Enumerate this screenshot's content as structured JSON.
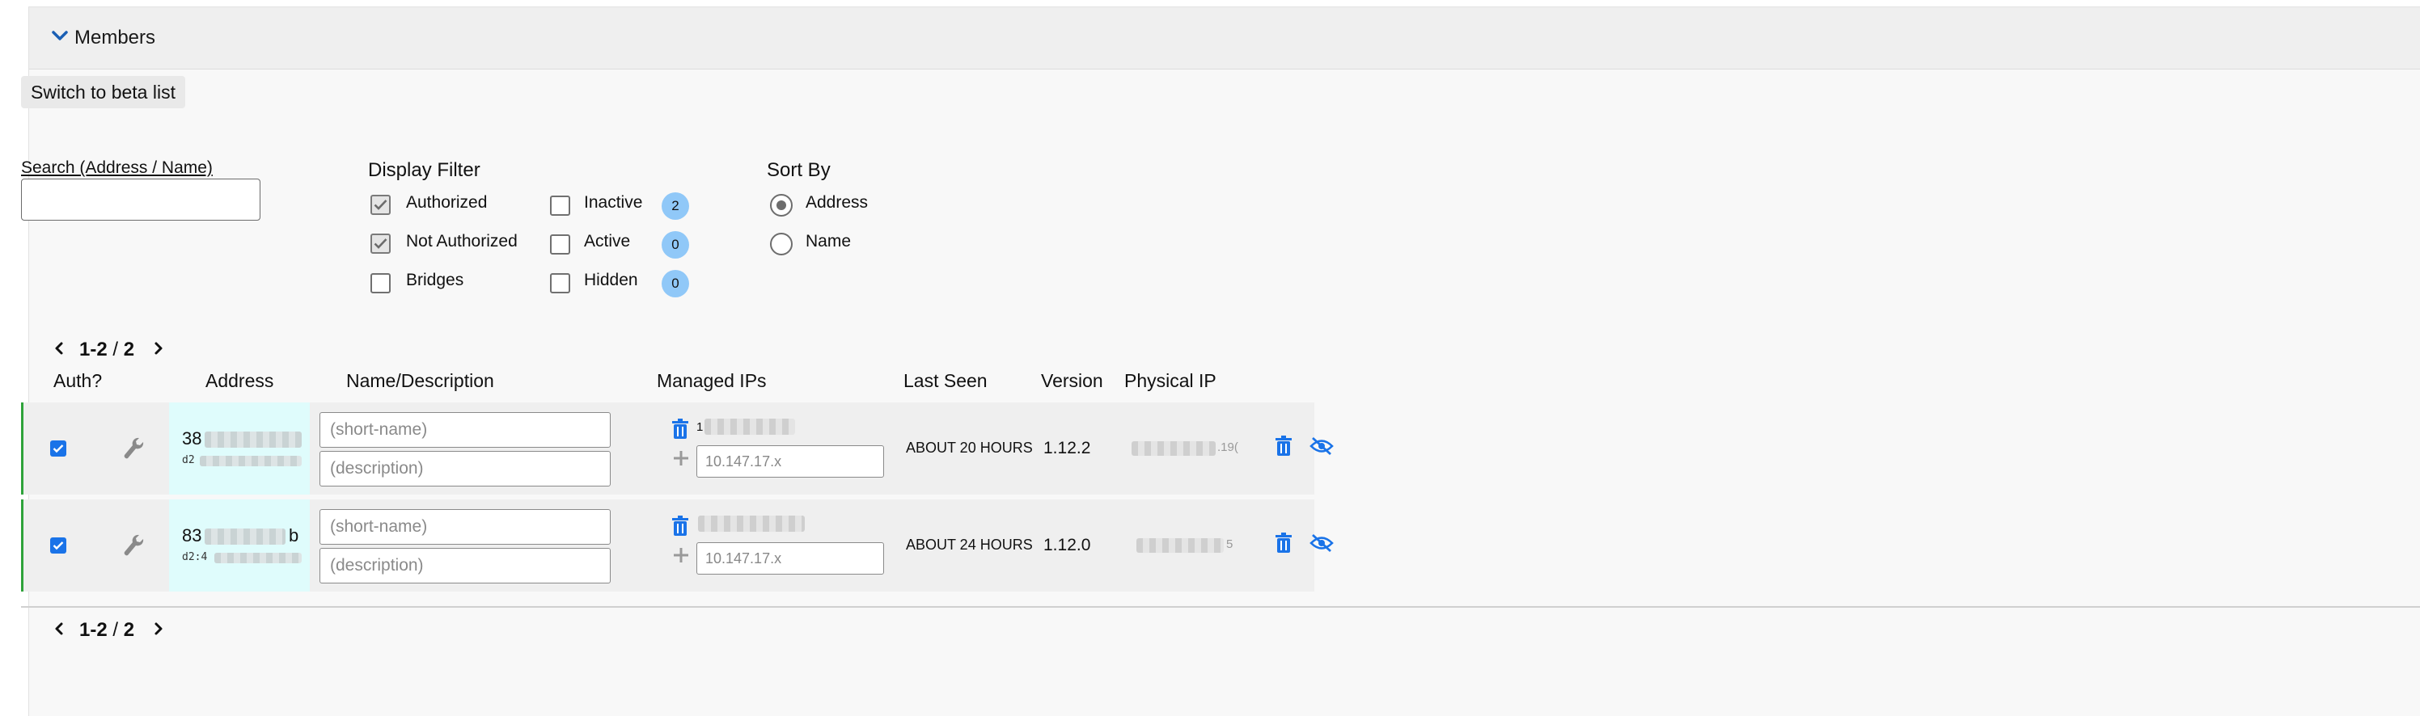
{
  "header": {
    "title": "Members"
  },
  "toolbar": {
    "beta_label": "Switch to beta list"
  },
  "search": {
    "label": "Search (Address / Name)",
    "value": "",
    "placeholder": ""
  },
  "display_filter": {
    "title": "Display Filter",
    "authorized": {
      "label": "Authorized",
      "checked": true
    },
    "not_authorized": {
      "label": "Not Authorized",
      "checked": true
    },
    "bridges": {
      "label": "Bridges",
      "checked": false
    },
    "inactive": {
      "label": "Inactive",
      "checked": false,
      "count": "2"
    },
    "active": {
      "label": "Active",
      "checked": false,
      "count": "0"
    },
    "hidden": {
      "label": "Hidden",
      "checked": false,
      "count": "0"
    }
  },
  "sort": {
    "title": "Sort By",
    "address": {
      "label": "Address",
      "selected": true
    },
    "name": {
      "label": "Name",
      "selected": false
    }
  },
  "pagination": {
    "range": "1-2",
    "separator": "/",
    "total": "2"
  },
  "table": {
    "headers": {
      "auth": "Auth?",
      "address": "Address",
      "name": "Name/Description",
      "managed_ips": "Managed IPs",
      "last_seen": "Last Seen",
      "version": "Version",
      "physical_ip": "Physical IP"
    },
    "rows": [
      {
        "authorized": true,
        "address_prefix": "38",
        "address_sub_prefix": "d2",
        "name_placeholder": "(short-name)",
        "desc_placeholder": "(description)",
        "managed_ip_prefix": "1",
        "ip_placeholder": "10.147.17.x",
        "last_seen": "ABOUT 20 HOURS",
        "version": "1.12.2",
        "physical_ip_tail": ".19("
      },
      {
        "authorized": true,
        "address_prefix": "83",
        "address_suffix": "b",
        "address_sub_prefix": "d2:4",
        "name_placeholder": "(short-name)",
        "desc_placeholder": "(description)",
        "managed_ip_prefix": "",
        "ip_placeholder": "10.147.17.x",
        "last_seen": "ABOUT 24 HOURS",
        "version": "1.12.0",
        "physical_ip_tail": "5"
      }
    ]
  },
  "colors": {
    "accent": "#1a73e8",
    "badge": "#90c8f8",
    "address_bg": "#dffcfc",
    "row_border": "#2fa33b"
  },
  "icons": [
    "chevron-down-icon",
    "chevron-left-icon",
    "chevron-right-icon",
    "wrench-icon",
    "trash-icon",
    "plus-icon",
    "eye-slash-icon"
  ]
}
